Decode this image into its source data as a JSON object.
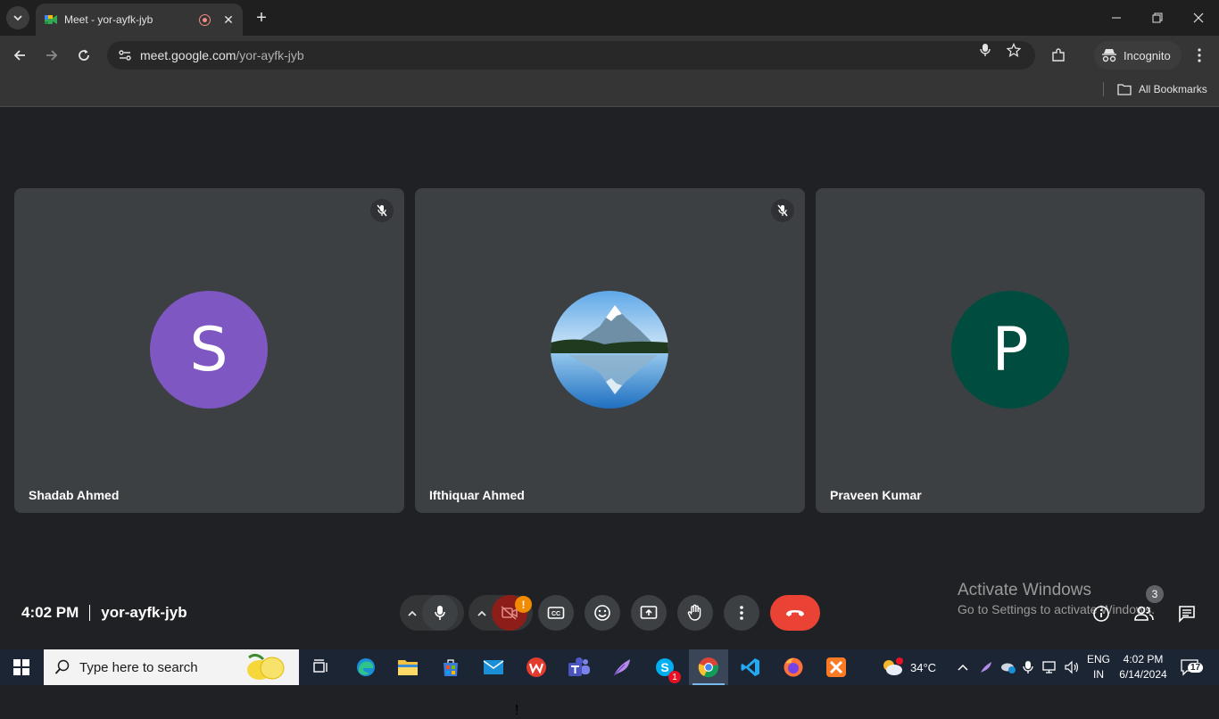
{
  "browser": {
    "tab_title": "Meet - yor-ayfk-jyb",
    "url_host": "meet.google.com",
    "url_path": "/yor-ayfk-jyb",
    "incognito_label": "Incognito",
    "bookmarks_label": "All Bookmarks"
  },
  "meeting": {
    "participants": [
      {
        "name": "Shadab Ahmed",
        "initial": "S",
        "avatar_color": "#7e57c2",
        "muted": true
      },
      {
        "name": "Ifthiquar Ahmed",
        "initial": "",
        "avatar_color": "#1e88e5",
        "muted": true
      },
      {
        "name": "Praveen Kumar",
        "initial": "P",
        "avatar_color": "#004d40",
        "muted": false
      }
    ],
    "time": "4:02 PM",
    "code": "yor-ayfk-jyb",
    "camera_alert": "!",
    "people_count": "3"
  },
  "watermark": {
    "line1": "Activate Windows",
    "line2": "Go to Settings to activate Windows."
  },
  "taskbar": {
    "search_placeholder": "Type here to search",
    "weather": "34°C",
    "lang1": "ENG",
    "lang2": "IN",
    "time": "4:02 PM",
    "date": "6/14/2024",
    "notifications": "17",
    "skype_badge": "1"
  },
  "colors": {
    "end_call": "#ea4335",
    "camera_off": "#b3261e"
  }
}
